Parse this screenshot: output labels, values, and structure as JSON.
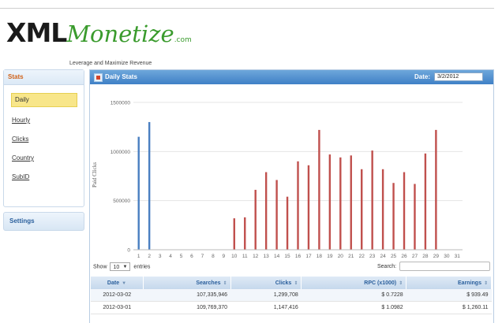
{
  "brand": {
    "logo_main": "XML",
    "logo_accent": "Monetize",
    "logo_suffix": ".com",
    "tagline": "Leverage and Maximize Revenue"
  },
  "sidebar": {
    "stats_heading": "Stats",
    "items": [
      {
        "label": "Daily",
        "active": true
      },
      {
        "label": "Hourly"
      },
      {
        "label": "Clicks"
      },
      {
        "label": "Country"
      },
      {
        "label": "SubID"
      }
    ],
    "settings_label": "Settings"
  },
  "panel": {
    "title": "Daily Stats",
    "date_label": "Date:",
    "date_value": "3/2/2012"
  },
  "chart_data": {
    "type": "bar",
    "ylabel": "Paid Clicks",
    "yticks": [
      "1500000",
      "1000000",
      "500000",
      "0"
    ],
    "ylim": [
      0,
      1500000
    ],
    "grid": true,
    "categories": [
      "1",
      "2",
      "3",
      "4",
      "5",
      "6",
      "7",
      "8",
      "9",
      "10",
      "11",
      "12",
      "13",
      "14",
      "15",
      "16",
      "17",
      "18",
      "19",
      "20",
      "21",
      "22",
      "23",
      "24",
      "25",
      "26",
      "27",
      "28",
      "29",
      "30",
      "31"
    ],
    "series": [
      {
        "color": "#4a7fc1",
        "values": [
          1150000,
          1300000,
          0,
          0,
          0,
          0,
          0,
          0,
          0,
          0,
          0,
          0,
          0,
          0,
          0,
          0,
          0,
          0,
          0,
          0,
          0,
          0,
          0,
          0,
          0,
          0,
          0,
          0,
          0,
          0,
          0
        ]
      },
      {
        "color": "#c0504d",
        "values": [
          0,
          0,
          0,
          0,
          0,
          0,
          0,
          0,
          0,
          320000,
          330000,
          610000,
          790000,
          710000,
          540000,
          900000,
          860000,
          1220000,
          970000,
          940000,
          960000,
          820000,
          1010000,
          820000,
          680000,
          790000,
          670000,
          980000,
          1220000,
          0,
          0
        ]
      }
    ]
  },
  "table": {
    "show_prefix": "Show",
    "show_value": "10",
    "show_suffix": "entries",
    "search_label": "Search:",
    "columns": [
      "Date",
      "Searches",
      "Clicks",
      "RPC (x1000)",
      "Earnings"
    ],
    "rows": [
      [
        "2012-03-02",
        "107,335,946",
        "1,299,708",
        "$ 0.7228",
        "$ 939.49"
      ],
      [
        "2012-03-01",
        "109,769,370",
        "1,147,416",
        "$ 1.0982",
        "$ 1,260.11"
      ]
    ]
  }
}
